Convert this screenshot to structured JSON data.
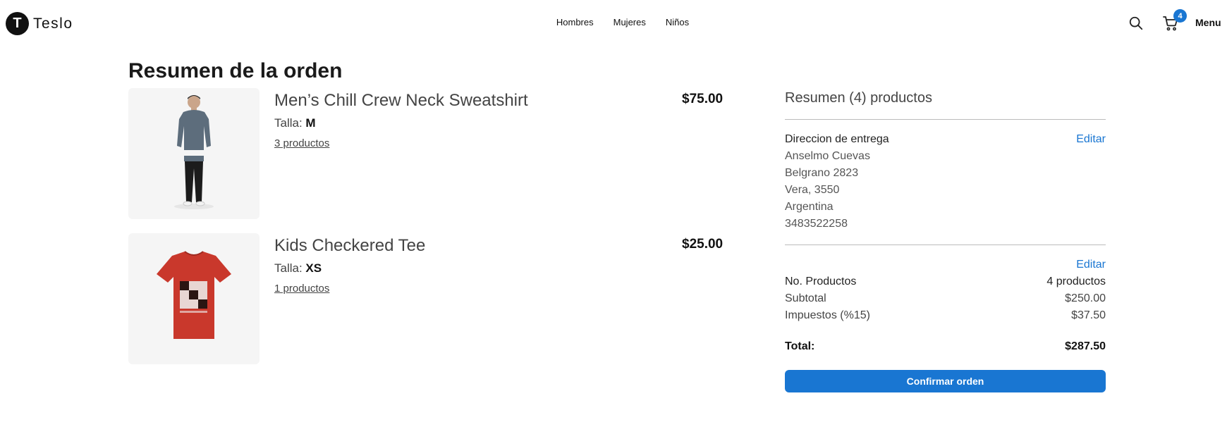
{
  "header": {
    "logo_letter": "T",
    "brand": "Teslo",
    "nav": [
      "Hombres",
      "Mujeres",
      "Niños"
    ],
    "cart_count": "4",
    "menu_label": "Menu"
  },
  "page_title": "Resumen de la orden",
  "products": [
    {
      "name": "Men’s Chill Crew Neck Sweatshirt",
      "size_label": "Talla: ",
      "size": "M",
      "quantity": "3 productos",
      "price": "$75.00",
      "image": "gray-sweatshirt-model"
    },
    {
      "name": "Kids Checkered Tee",
      "size_label": "Talla: ",
      "size": "XS",
      "quantity": "1 productos",
      "price": "$25.00",
      "image": "red-checkered-tee"
    }
  ],
  "summary": {
    "title": "Resumen (4) productos",
    "address_heading": "Direccion de entrega",
    "edit_label": "Editar",
    "address": [
      "Anselmo Cuevas",
      "Belgrano 2823",
      "Vera, 3550",
      "Argentina",
      "3483522258"
    ],
    "rows": [
      {
        "label": "No. Productos",
        "value": "4 productos"
      },
      {
        "label": "Subtotal",
        "value": "$250.00"
      },
      {
        "label": "Impuestos (%15)",
        "value": "$37.50"
      }
    ],
    "total_label": "Total:",
    "total_value": "$287.50",
    "confirm_label": "Confirmar orden"
  },
  "colors": {
    "accent": "#1976d2",
    "text": "#444444",
    "tee_red": "#c9382c"
  }
}
